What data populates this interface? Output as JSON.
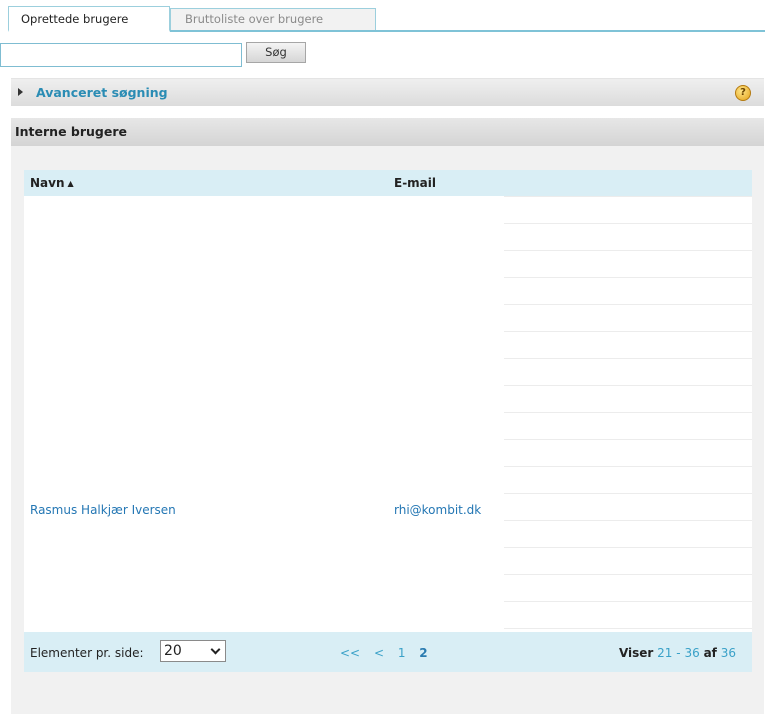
{
  "tabs": [
    {
      "label": "Oprettede brugere",
      "active": true
    },
    {
      "label": "Bruttoliste over brugere",
      "active": false
    }
  ],
  "search": {
    "value": "",
    "button_label": "Søg"
  },
  "advanced": {
    "label": "Avanceret søgning",
    "help_icon": "?"
  },
  "panel": {
    "title": "Interne brugere"
  },
  "table": {
    "columns": {
      "name": "Navn",
      "email": "E-mail"
    },
    "sort_icon": "▲",
    "rows": [
      {
        "name": "Rasmus Halkjær Iversen",
        "email": "rhi@kombit.dk"
      }
    ]
  },
  "footer": {
    "per_page_label": "Elementer pr. side:",
    "per_page_value": "20",
    "pager": {
      "first": "<<",
      "prev": "<",
      "pages": [
        "1",
        "2"
      ],
      "current": "2"
    },
    "viser": {
      "prefix": "Viser",
      "from": "21",
      "dash": "-",
      "to": "36",
      "of": "af",
      "total": "36"
    }
  },
  "colors": {
    "accent": "#2a8cb4",
    "link": "#2477b4",
    "header_bg": "#d9eef5"
  }
}
